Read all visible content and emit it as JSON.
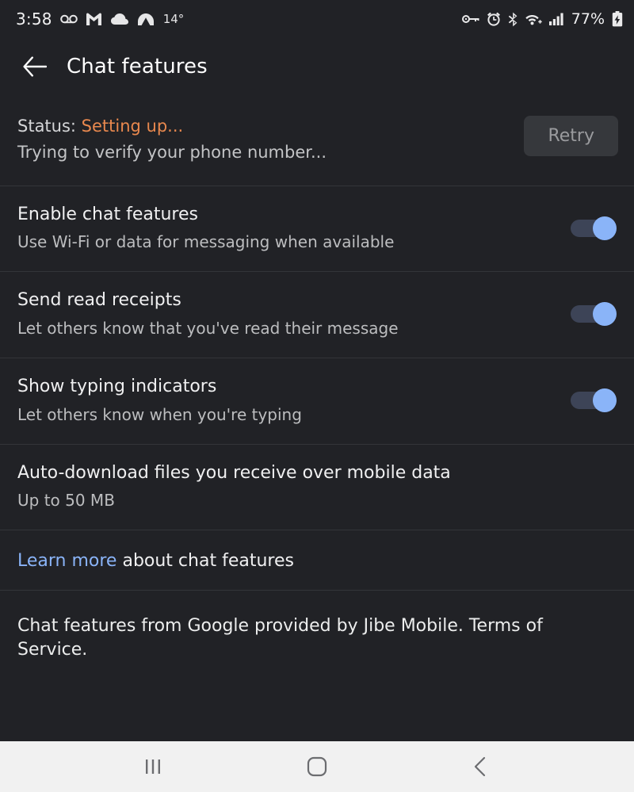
{
  "statusbar": {
    "time": "3:58",
    "temperature": "14°",
    "battery_percent": "77%",
    "left_icons": [
      "voicemail-icon",
      "gmail-icon",
      "cloud-icon",
      "weather-icon"
    ],
    "right_icons": [
      "vpn-key-icon",
      "alarm-icon",
      "bluetooth-icon",
      "wifi-icon",
      "signal-icon",
      "battery-charging-icon"
    ]
  },
  "appbar": {
    "back_icon": "back-arrow-icon",
    "title": "Chat features"
  },
  "status_section": {
    "label": "Status: ",
    "value": "Setting up...",
    "detail": "Trying to verify your phone number...",
    "retry_label": "Retry",
    "value_color": "#e8884e"
  },
  "rows": [
    {
      "title": "Enable chat features",
      "subtitle": "Use Wi-Fi or data for messaging when available",
      "toggle": "on"
    },
    {
      "title": "Send read receipts",
      "subtitle": "Let others know that you've read their message",
      "toggle": "on"
    },
    {
      "title": "Show typing indicators",
      "subtitle": "Let others know when you're typing",
      "toggle": "on"
    },
    {
      "title": "Auto-download files you receive over mobile data",
      "subtitle": "Up to 50 MB",
      "toggle": "none"
    }
  ],
  "learn_more": {
    "link_text": "Learn more",
    "rest_text": " about chat features",
    "link_color": "#8ab4f8"
  },
  "legal": {
    "text": "Chat features from Google provided by Jibe Mobile. Terms of Service."
  },
  "navbar": {
    "recents_icon": "recents-icon",
    "home_icon": "home-icon",
    "back_icon": "nav-back-icon"
  },
  "colors": {
    "background": "#212226",
    "divider": "#333539",
    "toggle_thumb": "#8ab4f8",
    "toggle_track": "#3d4457",
    "navbar_bg": "#f1f1f1"
  }
}
